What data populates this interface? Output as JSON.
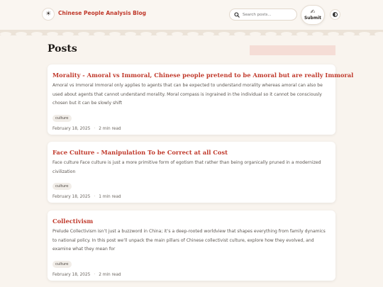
{
  "header": {
    "logo_icon": "sun-icon",
    "site_title": "Chinese People Analysis Blog",
    "search": {
      "placeholder": "Search posts..."
    },
    "submit": {
      "icon": "writing-hand-icon",
      "label": "Submit"
    },
    "theme_toggle_icon": "half-circle-icon"
  },
  "main": {
    "page_title": "Posts",
    "posts": [
      {
        "title": "Morality - Amoral vs Immoral, Chinese people pretend to be Amoral but are really Immoral",
        "excerpt": "Amoral vs Immoral Immoral only applies to agents that can be expected to understand morality whereas amoral can also be used about agents that cannot understand morality. Moral compass is ingrained in the individual so it cannot be consciously chosen but it can be slowly shift",
        "tag": "culture",
        "date": "February 18, 2025",
        "read_time": "2 min read"
      },
      {
        "title": "Face Culture - Manipulation To be Correct at all Cost",
        "excerpt": "Face culture Face culture is just a more primitive form of egotism that rather than being organically pruned in a modernized civilization",
        "tag": "culture",
        "date": "February 18, 2025",
        "read_time": "1 min read"
      },
      {
        "title": "Collectivism",
        "excerpt": "Prelude Collectivism isn’t just a buzzword in China; it’s a deep-rooted worldview that shapes everything from family dynamics to national policy. In this post we’ll unpack the main pillars of Chinese collectivist culture, explore how they evolved, and examine what they mean for",
        "tag": "culture",
        "date": "February 18, 2025",
        "read_time": "2 min read"
      }
    ]
  },
  "colors": {
    "accent": "#c0392b",
    "background": "#f9f4ee",
    "card": "#ffffff",
    "highlight": "#f5ddd6"
  }
}
